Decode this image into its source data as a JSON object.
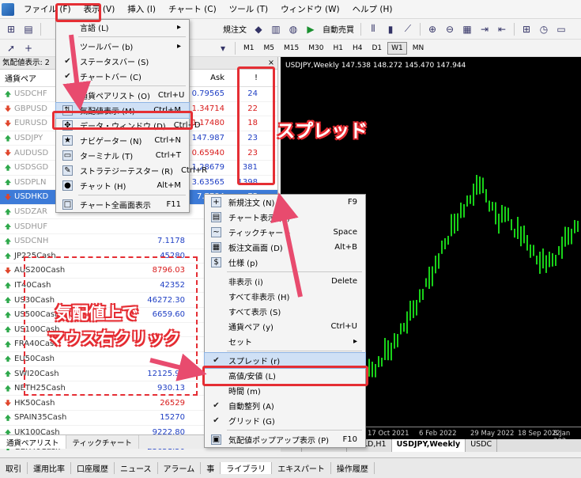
{
  "menubar": [
    "ファイル (F)",
    "表示 (V)",
    "挿入 (I)",
    "チャート (C)",
    "ツール (T)",
    "ウィンドウ (W)",
    "ヘルプ (H)"
  ],
  "toolbar": {
    "new_order": "規注文",
    "auto_trade": "自動売買"
  },
  "timeframes": [
    "M1",
    "M5",
    "M15",
    "M30",
    "H1",
    "H4",
    "D1",
    "W1",
    "MN"
  ],
  "market_watch": {
    "title": "気配値表示: 2",
    "headers": {
      "symbol": "通貨ペア",
      "ask": "Ask",
      "spread": "!"
    },
    "rows": [
      {
        "sym": "USDCHF",
        "bid": "",
        "ask": "0.79565",
        "spr": "24",
        "dir": "up",
        "dim": true,
        "sel": false
      },
      {
        "sym": "GBPUSD",
        "bid": "",
        "ask": "1.34714",
        "spr": "22",
        "dir": "dn",
        "dim": true,
        "sel": false
      },
      {
        "sym": "EURUSD",
        "bid": "",
        "ask": "1.17480",
        "spr": "18",
        "dir": "dn",
        "dim": true,
        "sel": false
      },
      {
        "sym": "USDJPY",
        "bid": "",
        "ask": "147.987",
        "spr": "23",
        "dir": "up",
        "dim": true,
        "sel": false
      },
      {
        "sym": "AUDUSD",
        "bid": "",
        "ask": "0.65940",
        "spr": "23",
        "dir": "dn",
        "dim": true,
        "sel": false
      },
      {
        "sym": "USDSGD",
        "bid": "",
        "ask": "1.28679",
        "spr": "381",
        "dir": "up",
        "dim": true,
        "sel": false
      },
      {
        "sym": "USDPLN",
        "bid": "",
        "ask": "3.63565",
        "spr": "1398",
        "dir": "up",
        "dim": true,
        "sel": false
      },
      {
        "sym": "USDHKD",
        "bid": "",
        "ask": "7.7784",
        "spr": "75",
        "dir": "dn",
        "dim": false,
        "sel": true
      },
      {
        "sym": "USDZAR",
        "bid": "",
        "ask": "",
        "spr": "",
        "dir": "up",
        "dim": true,
        "sel": false
      },
      {
        "sym": "USDHUF",
        "bid": "",
        "ask": "",
        "spr": "",
        "dir": "up",
        "dim": true,
        "sel": false
      },
      {
        "sym": "USDCNH",
        "bid": "7.1178",
        "ask": "",
        "spr": "",
        "dir": "up",
        "dim": true,
        "sel": false
      },
      {
        "sym": "JP225Cash",
        "bid": "45280",
        "ask": "",
        "spr": "",
        "dir": "up",
        "dim": false,
        "sel": false
      },
      {
        "sym": "AUS200Cash",
        "bid": "8796.03",
        "ask": "",
        "spr": "",
        "dir": "dn",
        "dim": false,
        "sel": false
      },
      {
        "sym": "IT40Cash",
        "bid": "42352",
        "ask": "",
        "spr": "",
        "dir": "up",
        "dim": false,
        "sel": false
      },
      {
        "sym": "US30Cash",
        "bid": "46272.30",
        "ask": "",
        "spr": "",
        "dir": "up",
        "dim": false,
        "sel": false
      },
      {
        "sym": "US500Cash",
        "bid": "6659.60",
        "ask": "",
        "spr": "",
        "dir": "up",
        "dim": false,
        "sel": false
      },
      {
        "sym": "US100Cash",
        "bid": "",
        "ask": "",
        "spr": "",
        "dir": "up",
        "dim": false,
        "sel": false
      },
      {
        "sym": "FRA40Cash",
        "bid": "",
        "ask": "",
        "spr": "",
        "dir": "up",
        "dim": false,
        "sel": false
      },
      {
        "sym": "EU50Cash",
        "bid": "",
        "ask": "",
        "spr": "",
        "dir": "up",
        "dim": false,
        "sel": false
      },
      {
        "sym": "SWI20Cash",
        "bid": "12125.93",
        "ask": "",
        "spr": "",
        "dir": "up",
        "dim": false,
        "sel": false
      },
      {
        "sym": "NETH25Cash",
        "bid": "930.13",
        "ask": "",
        "spr": "",
        "dir": "up",
        "dim": false,
        "sel": false
      },
      {
        "sym": "HK50Cash",
        "bid": "26529",
        "ask": "",
        "spr": "",
        "dir": "dn",
        "dim": false,
        "sel": false
      },
      {
        "sym": "SPAIN35Cash",
        "bid": "15270",
        "ask": "",
        "spr": "",
        "dir": "up",
        "dim": false,
        "sel": false
      },
      {
        "sym": "UK100Cash",
        "bid": "9222.80",
        "ask": "",
        "spr": "",
        "dir": "up",
        "dim": false,
        "sel": false
      },
      {
        "sym": "GER40Cash",
        "bid": "23651.50",
        "ask": "",
        "spr": "",
        "dir": "up",
        "dim": false,
        "sel": false
      }
    ],
    "tabs": [
      "通貨ペアリスト",
      "ティックチャート"
    ]
  },
  "view_menu": [
    {
      "label": "言語 (L)",
      "sc": "",
      "sub": true
    },
    {
      "sep": true
    },
    {
      "label": "ツールバー (b)",
      "sc": "",
      "sub": true
    },
    {
      "label": "ステータスバー (S)",
      "sc": "",
      "check": true
    },
    {
      "label": "チャートバー (C)",
      "sc": "",
      "check": true
    },
    {
      "sep": true
    },
    {
      "label": "通貨ペアリスト (O)",
      "sc": "Ctrl+U"
    },
    {
      "label": "気配値表示 (M)",
      "sc": "Ctrl+M",
      "hl": true,
      "icon": "⇅"
    },
    {
      "label": "データ・ウィンドウ (D)",
      "sc": "Ctrl+D",
      "icon": "✥"
    },
    {
      "label": "ナビゲーター (N)",
      "sc": "Ctrl+N",
      "icon": "★"
    },
    {
      "label": "ターミナル (T)",
      "sc": "Ctrl+T",
      "icon": "▭"
    },
    {
      "label": "ストラテジーテスター (R)",
      "sc": "Ctrl+R",
      "icon": "✎"
    },
    {
      "label": "チャット (H)",
      "sc": "Alt+M",
      "icon": "●"
    },
    {
      "sep": true
    },
    {
      "label": "チャート全画面表示",
      "sc": "F11",
      "icon": "□"
    }
  ],
  "context_menu": [
    {
      "label": "新規注文 (N)",
      "sc": "F9",
      "icon": "+"
    },
    {
      "label": "チャート表示 (C)",
      "sc": "",
      "icon": "▤"
    },
    {
      "label": "ティックチャート",
      "sc": "Space",
      "icon": "~"
    },
    {
      "label": "板注文画面 (D)",
      "sc": "Alt+B",
      "icon": "▦"
    },
    {
      "label": "仕様 (p)",
      "sc": "",
      "icon": "$"
    },
    {
      "sep": true
    },
    {
      "label": "非表示 (i)",
      "sc": "Delete"
    },
    {
      "label": "すべて非表示 (H)",
      "sc": ""
    },
    {
      "label": "すべて表示 (S)",
      "sc": ""
    },
    {
      "label": "通貨ペア (y)",
      "sc": "Ctrl+U"
    },
    {
      "label": "セット",
      "sc": "",
      "sub": true
    },
    {
      "sep": true
    },
    {
      "label": "スプレッド (r)",
      "sc": "",
      "check": true,
      "hl": true
    },
    {
      "label": "高値/安値 (L)",
      "sc": ""
    },
    {
      "label": "時間 (m)",
      "sc": ""
    },
    {
      "label": "自動整列 (A)",
      "sc": "",
      "check": true
    },
    {
      "label": "グリッド (G)",
      "sc": "",
      "check": true
    },
    {
      "sep": true
    },
    {
      "label": "気配値ポップアップ表示 (P)",
      "sc": "F10",
      "icon": "▣"
    }
  ],
  "chart": {
    "title": "USDJPY,Weekly  147.538 148.272 145.470 147.944",
    "dates": [
      "17 Oct 2021",
      "6 Feb 2022",
      "29 May 2022",
      "18 Sep 2022",
      "8 Jan 202"
    ],
    "candle_color": "#19d119"
  },
  "chart_tabs": [
    "M5",
    "GOLD,H1",
    "GOLD,H1",
    "USDJPY,Weekly",
    "USDC"
  ],
  "bottom_tabs": [
    "取引",
    "運用比率",
    "口座履歴",
    "ニュース",
    "アラーム",
    "事",
    "ライブラリ",
    "エキスパート",
    "操作履歴"
  ],
  "annotations": {
    "spread": "スプレッド",
    "right_click_1": "気配値上で",
    "right_click_2": "マウス右クリック",
    "accent": "#e52e34"
  }
}
